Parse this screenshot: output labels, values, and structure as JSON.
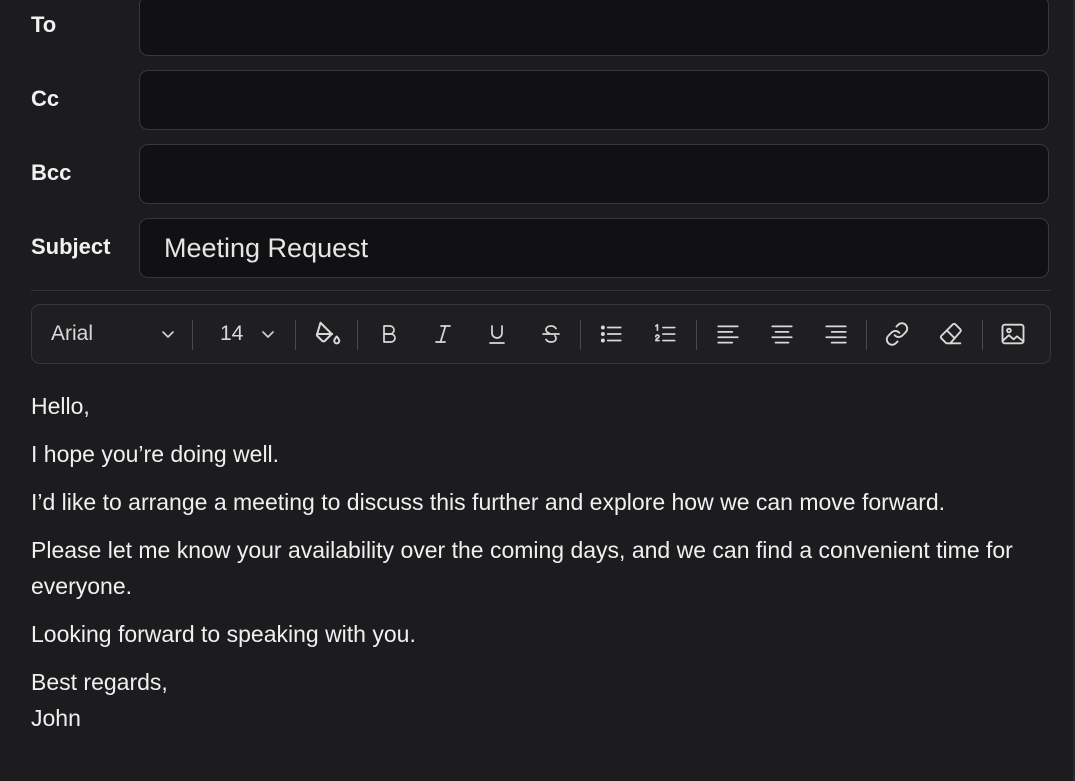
{
  "fields": {
    "to": {
      "label": "To",
      "value": ""
    },
    "cc": {
      "label": "Cc",
      "value": ""
    },
    "bcc": {
      "label": "Bcc",
      "value": ""
    },
    "subject": {
      "label": "Subject",
      "value": "Meeting Request"
    }
  },
  "toolbar": {
    "font_family": "Arial",
    "font_size": "14",
    "icons": [
      "chevron-down-icon",
      "paint-bucket-icon",
      "bold-icon",
      "italic-icon",
      "underline-icon",
      "strikethrough-icon",
      "bullet-list-icon",
      "numbered-list-icon",
      "align-left-icon",
      "align-center-icon",
      "align-right-icon",
      "link-icon",
      "eraser-icon",
      "image-icon"
    ]
  },
  "body": {
    "greeting": "Hello,",
    "line1": "I hope you’re doing well.",
    "line2": "I’d like to arrange a meeting to discuss this further and explore how we can move forward.",
    "line3": "Please let me know your availability over the coming days, and we can find a convenient time for everyone.",
    "line4": "Looking forward to speaking with you.",
    "closing": "Best regards,",
    "signature": "John"
  },
  "colors": {
    "background": "#1c1c1e",
    "input_background": "#111113",
    "border": "#38383b",
    "text": "#f0f0f0"
  }
}
